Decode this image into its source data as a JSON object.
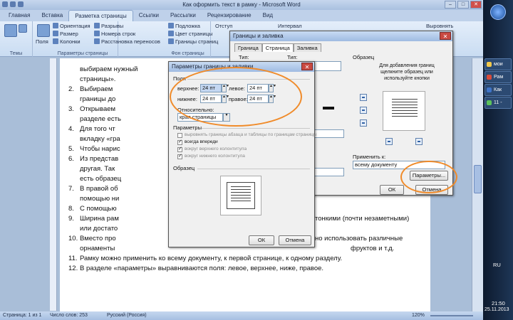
{
  "window": {
    "title": "Как оформить текст в рамку - Microsoft Word",
    "min": "–",
    "max": "□",
    "close": "✕"
  },
  "tabs": [
    "Главная",
    "Вставка",
    "Разметка страницы",
    "Ссылки",
    "Рассылки",
    "Рецензирование",
    "Вид"
  ],
  "active_tab": "Разметка страницы",
  "ribbon": {
    "themes_label": "Темы",
    "fields_label": "Поля",
    "orientation": "Ориентация",
    "size": "Размер",
    "columns": "Колонки",
    "breaks": "Разрывы",
    "line_numbers": "Номера строк",
    "hyphenation": "Расстановка переносов",
    "page_setup_label": "Параметры страницы",
    "watermark": "Подложка",
    "page_color": "Цвет страницы",
    "page_borders": "Границы страниц",
    "page_bg_label": "Фон страницы",
    "indent": "Отступ",
    "spacing": "Интервал",
    "arrange": "Выровнять"
  },
  "document": {
    "lines": [
      {
        "n": "",
        "text": "выбираем нужный"
      },
      {
        "n": "",
        "text": "страницы»."
      },
      {
        "n": "2.",
        "text": "Выбираем"
      },
      {
        "n": "",
        "text": "границы до"
      },
      {
        "n": "3.",
        "text": "Открываем"
      },
      {
        "n": "",
        "text": "разделе есть"
      },
      {
        "n": "4.",
        "text": "Для того чт"
      },
      {
        "n": "",
        "text": "вкладку «гра"
      },
      {
        "n": "5.",
        "text": "Чтобы нарис"
      },
      {
        "n": "6.",
        "text": "Из представ"
      },
      {
        "n": "",
        "text": "другая. Так"
      },
      {
        "n": "",
        "text": "есть образец"
      },
      {
        "n": "7.",
        "text": "В правой об"
      },
      {
        "n": "",
        "text": "помощью ни"
      },
      {
        "n": "8.",
        "text": "С помощью"
      },
      {
        "n": "9.",
        "text": "Ширина рам"
      },
      {
        "n": "",
        "text": "или достато"
      },
      {
        "n": "10.",
        "text": "Вместо про"
      },
      {
        "n": "",
        "text": "орнаменты"
      },
      {
        "n": "11.",
        "text": "Рамку можно применить ко всему документу, к первой странице, к одному разделу."
      },
      {
        "n": "12.",
        "text": "В разделе «параметры» выравниваются поля: левое, верхнее, ниже, правое."
      }
    ],
    "tail_9": "тонкими (почти незаметными)",
    "tail_10a": "но использовать различные",
    "tail_10b": "фруктов и т.д."
  },
  "status": {
    "page": "Страница: 1 из 1",
    "words": "Число слов: 253",
    "lang": "Русский (Россия)",
    "zoom": "120%"
  },
  "taskbar": {
    "items": [
      "мои",
      "Рам",
      "Как",
      "11 -"
    ],
    "lang": "RU",
    "time": "21:50",
    "date": "25.11.2013"
  },
  "borders_dialog": {
    "title": "Границы и заливка",
    "tabs": [
      "Граница",
      "Страница",
      "Заливка"
    ],
    "type_label": "Тип:",
    "type_label2": "Тип:",
    "sample_label": "Образец",
    "sample_hint": "Для добавления границ щелкните образец или используйте кнопки",
    "apply_label": "Применить к:",
    "apply_value": "всему документу",
    "params_button": "Параметры...",
    "ok": "ОК",
    "cancel": "Отмена"
  },
  "params_dialog": {
    "title": "Параметры границы и заливки",
    "fields_label": "Поля",
    "top_label": "верхнее:",
    "top_value": "24 пт",
    "left_label": "левое:",
    "left_value": "24 пт",
    "bottom_label": "нижнее:",
    "bottom_value": "24 пт",
    "right_label": "правое:",
    "right_value": "24 пт",
    "relative_label": "Относительно:",
    "relative_value": "края страницы",
    "params_label": "Параметры",
    "opt1": "выровнять границы абзаца и таблицы по границам страницы",
    "opt2": "всегда впереди",
    "opt3": "вокруг верхнего колонтитула",
    "opt4": "вокруг нижнего колонтитула",
    "sample_label": "Образец",
    "ok": "ОК",
    "cancel": "Отмена",
    "close": "✕"
  }
}
